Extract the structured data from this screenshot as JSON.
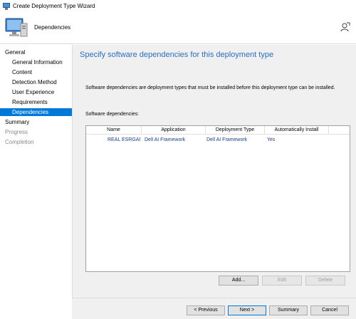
{
  "window": {
    "title": "Create Deployment Type Wizard"
  },
  "header": {
    "page_name": "Dependencies"
  },
  "nav": {
    "items": [
      {
        "label": "General",
        "level": "top",
        "state": "normal"
      },
      {
        "label": "General Information",
        "level": "sub",
        "state": "normal"
      },
      {
        "label": "Content",
        "level": "sub",
        "state": "normal"
      },
      {
        "label": "Detection Method",
        "level": "sub",
        "state": "normal"
      },
      {
        "label": "User Experience",
        "level": "sub",
        "state": "normal"
      },
      {
        "label": "Requirements",
        "level": "sub",
        "state": "normal"
      },
      {
        "label": "Dependencies",
        "level": "sub",
        "state": "selected"
      },
      {
        "label": "Summary",
        "level": "top",
        "state": "normal"
      },
      {
        "label": "Progress",
        "level": "top",
        "state": "disabled"
      },
      {
        "label": "Completion",
        "level": "top",
        "state": "disabled"
      }
    ]
  },
  "main": {
    "heading": "Specify software dependencies for this deployment type",
    "description": "Software dependencies are deployment types that must be installed before this deployment type can be installed.",
    "list_label": "Software dependencies:",
    "table": {
      "columns": [
        "Name",
        "Application",
        "Deployment Type",
        "Automatically Install"
      ],
      "rows": [
        [
          "REAL ESRGAN",
          "Dell AI Framework",
          "Dell AI Framework",
          "Yes"
        ]
      ]
    },
    "buttons": {
      "add": "Add...",
      "edit": "Edit",
      "delete": "Delete"
    }
  },
  "footer": {
    "previous": "< Previous",
    "next": "Next >",
    "summary": "Summary",
    "cancel": "Cancel"
  },
  "colors": {
    "accent": "#0078d7",
    "heading": "#2a6ebb",
    "cell_text": "#1a3f8c"
  }
}
